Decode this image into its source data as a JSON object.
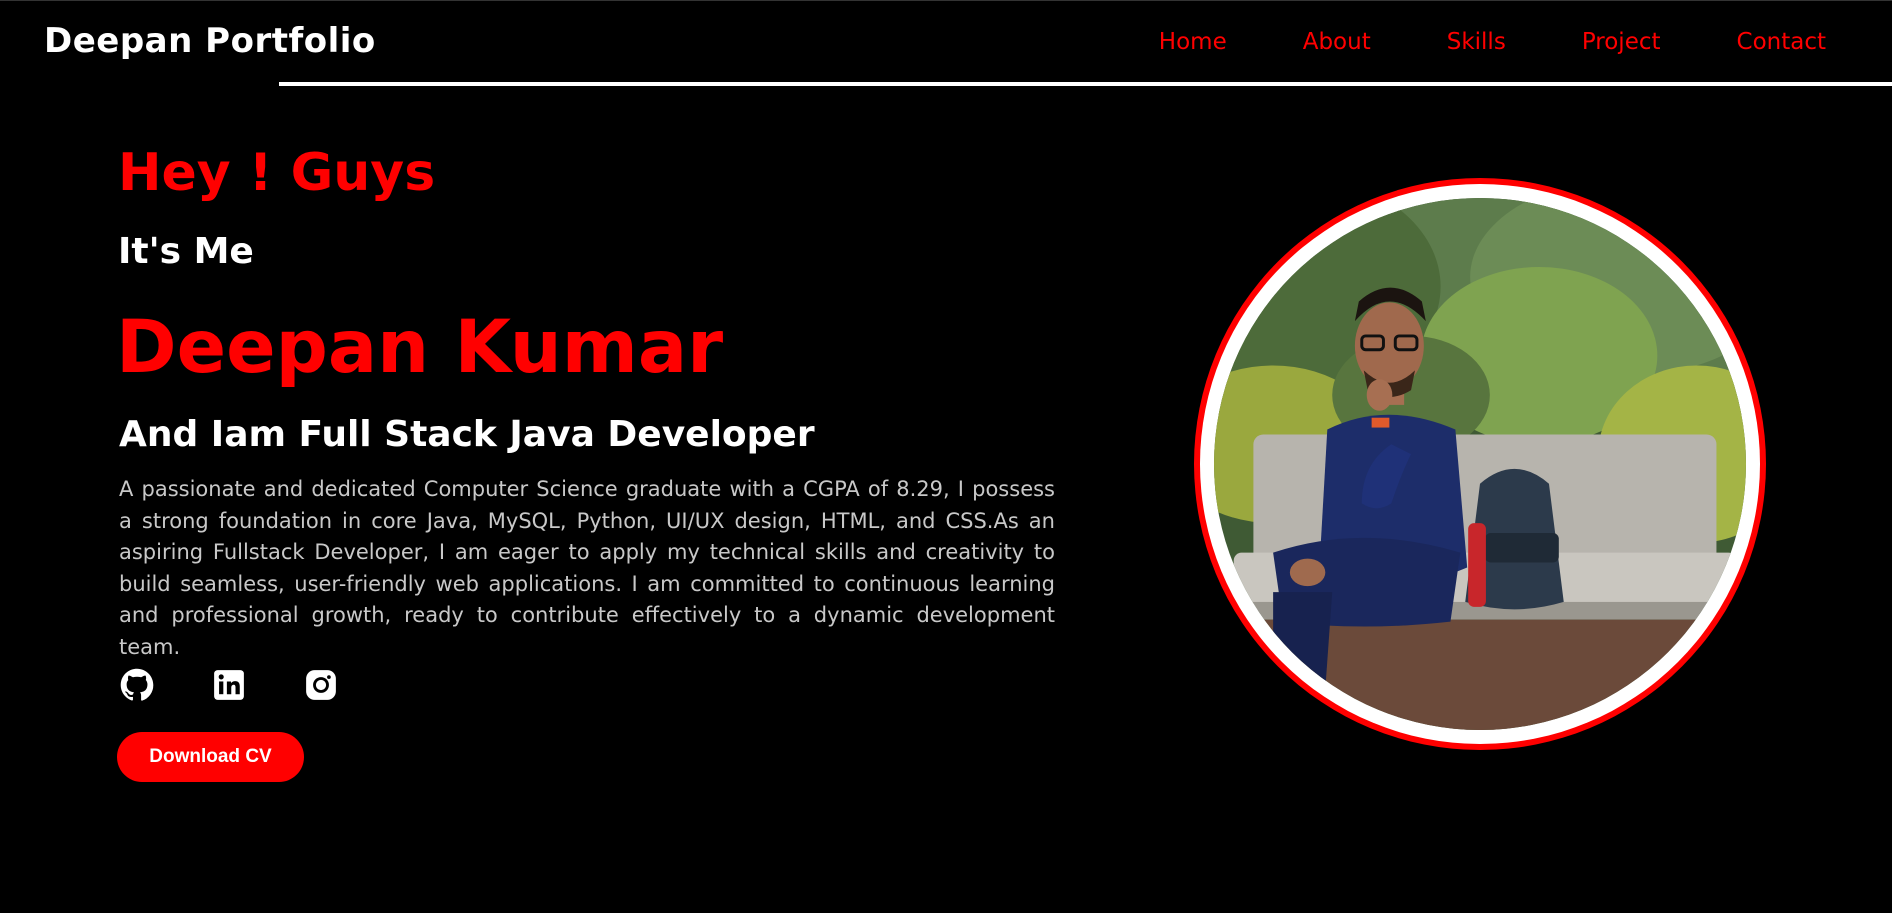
{
  "header": {
    "brand": "Deepan Portfolio",
    "nav": [
      "Home",
      "About",
      "Skills",
      "Project",
      "Contact"
    ]
  },
  "hero": {
    "greeting": "Hey ! Guys",
    "intro": "It's Me",
    "name": "Deepan Kumar",
    "role": "And Iam Full Stack Java Developer",
    "description": "A passionate and dedicated Computer Science graduate with a CGPA of 8.29, I possess a strong foundation in core Java, MySQL, Python, UI/UX design, HTML, and CSS.As an aspiring Fullstack Developer, I am eager to apply my technical skills and creativity to build seamless, user-friendly web applications. I am committed to continuous learning and professional growth, ready to contribute effectively to a dynamic development team.",
    "socials": [
      "github-icon",
      "linkedin-icon",
      "instagram-icon"
    ],
    "cv_button": "Download CV"
  },
  "profile_photo": {
    "description_icon": "profile-photo"
  },
  "colors": {
    "background": "#000000",
    "accent": "#ff0000",
    "text": "#ffffff",
    "body_text": "#c8c8c8"
  }
}
